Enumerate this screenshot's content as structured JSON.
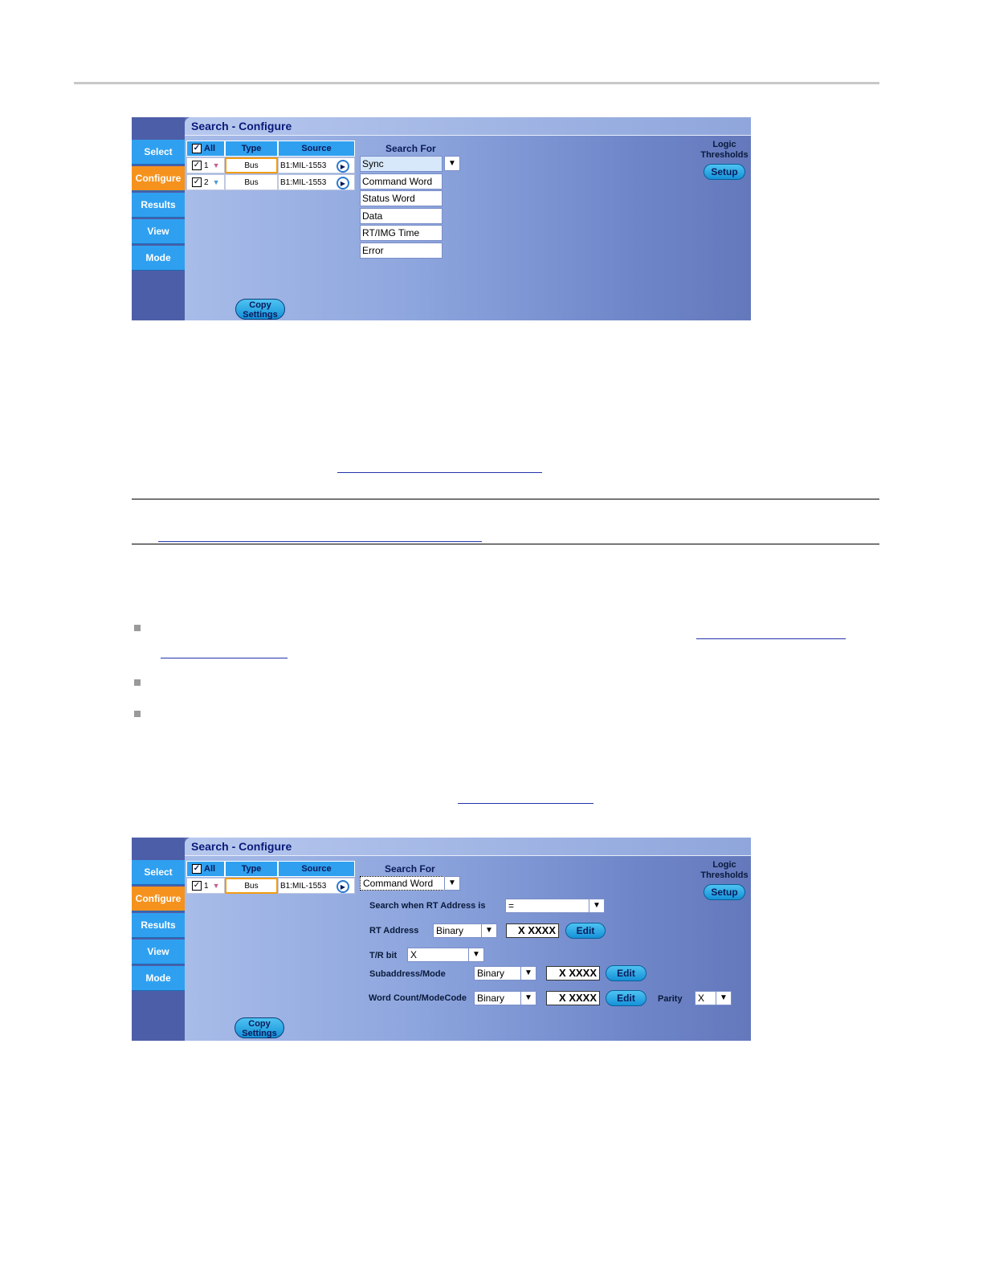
{
  "panel1": {
    "title": "Search - Configure",
    "side_buttons": [
      "Select",
      "Configure",
      "Results",
      "View",
      "Mode"
    ],
    "active_side": "Configure",
    "table_headers": {
      "all": "All",
      "type": "Type",
      "source": "Source"
    },
    "rows": [
      {
        "num": "1",
        "type": "Bus",
        "source": "B1:MIL-1553"
      },
      {
        "num": "2",
        "type": "Bus",
        "source": "B1:MIL-1553"
      }
    ],
    "search_for_label": "Search For",
    "search_for_options": [
      "Sync",
      "Command Word",
      "Status Word",
      "Data",
      "RT/IMG Time",
      "Error"
    ],
    "logic_label_1": "Logic",
    "logic_label_2": "Thresholds",
    "setup_label": "Setup",
    "copy_label_1": "Copy",
    "copy_label_2": "Settings"
  },
  "panel2": {
    "title": "Search - Configure",
    "side_buttons": [
      "Select",
      "Configure",
      "Results",
      "View",
      "Mode"
    ],
    "active_side": "Configure",
    "table_headers": {
      "all": "All",
      "type": "Type",
      "source": "Source"
    },
    "rows": [
      {
        "num": "1",
        "type": "Bus",
        "source": "B1:MIL-1553"
      }
    ],
    "search_for_label": "Search For",
    "search_for_value": "Command Word",
    "rt_cond_label": "Search when RT Address is",
    "rt_cond_value": "=",
    "rt_address_label": "RT Address",
    "rt_address_format": "Binary",
    "rt_address_value": "X XXXX",
    "tr_label": "T/R bit",
    "tr_value": "X",
    "sub_label": "Subaddress/Mode",
    "sub_format": "Binary",
    "sub_value": "X XXXX",
    "wc_label": "Word Count/ModeCode",
    "wc_format": "Binary",
    "wc_value": "X XXXX",
    "parity_label": "Parity",
    "parity_value": "X",
    "edit_label": "Edit",
    "logic_label_1": "Logic",
    "logic_label_2": "Thresholds",
    "setup_label": "Setup",
    "copy_label_1": "Copy",
    "copy_label_2": "Settings"
  },
  "colors": {
    "accent_blue": "#2fa0f0",
    "active_orange": "#f5921e",
    "title_navy": "#0a1a7a"
  }
}
